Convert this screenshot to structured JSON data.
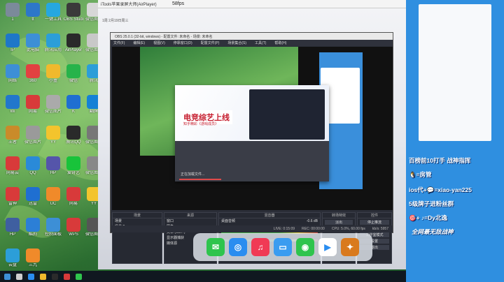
{
  "airplayer": {
    "title": "iTools苹果录屏大师(AirPlayer)",
    "fps": "58fps",
    "subtitle": "1周  2月19日周三"
  },
  "desktop_icons": [
    {
      "label": "1",
      "icon": "recycle-bin-icon",
      "color": "#7b8a9a"
    },
    {
      "label": "tt",
      "icon": "app-icon",
      "color": "#2d77c9"
    },
    {
      "label": "一键工具",
      "icon": "tool-icon",
      "color": "#26a7e0"
    },
    {
      "label": "OBS Studio",
      "icon": "obs-icon",
      "color": "#3a3a3a"
    },
    {
      "label": "微信图片",
      "icon": "image-icon",
      "color": "#d7d7d7"
    },
    {
      "label": "IP",
      "icon": "app-icon",
      "color": "#1e77c8"
    },
    {
      "label": "此电脑",
      "icon": "computer-icon",
      "color": "#3d8fd6"
    },
    {
      "label": "腾讯应用",
      "icon": "app-icon",
      "color": "#2c9ed8"
    },
    {
      "label": "AirPlayer",
      "icon": "airplayer-icon",
      "color": "#2a2a2a"
    },
    {
      "label": "微信图片",
      "icon": "image-icon",
      "color": "#c8c8c8"
    },
    {
      "label": "网络",
      "icon": "network-icon",
      "color": "#3d8fd6"
    },
    {
      "label": "360",
      "icon": "app-icon",
      "color": "#e24141"
    },
    {
      "label": "小盒",
      "icon": "app-icon",
      "color": "#f0b92d"
    },
    {
      "label": "微信",
      "icon": "wechat-icon",
      "color": "#27b34a"
    },
    {
      "label": "腾讯",
      "icon": "app-icon",
      "color": "#2c9ed8"
    },
    {
      "label": "Wi",
      "icon": "app-icon",
      "color": "#2277cc"
    },
    {
      "label": "网易",
      "icon": "app-icon",
      "color": "#d83a3a"
    },
    {
      "label": "微信图片",
      "icon": "image-icon",
      "color": "#aaaaaa"
    },
    {
      "label": "K",
      "icon": "app-icon",
      "color": "#1f6fd1"
    },
    {
      "label": "翻牌",
      "icon": "app-icon",
      "color": "#1581d6"
    },
    {
      "label": "王者",
      "icon": "game-icon",
      "color": "#c98b2a"
    },
    {
      "label": "微信图片",
      "icon": "image-icon",
      "color": "#9a9a9a"
    },
    {
      "label": "YY",
      "icon": "yy-icon",
      "color": "#f3c42d"
    },
    {
      "label": "腾讯QQ",
      "icon": "qq-icon",
      "color": "#2a2a2a"
    },
    {
      "label": "微信图片",
      "icon": "image-icon",
      "color": "#777"
    },
    {
      "label": "网易云",
      "icon": "music-icon",
      "color": "#d83a3a"
    },
    {
      "label": "QQ",
      "icon": "qq-icon",
      "color": "#2a8ad8"
    },
    {
      "label": "HP",
      "icon": "app-icon",
      "color": "#5555aa"
    },
    {
      "label": "爱奇艺",
      "icon": "iqiyi-icon",
      "color": "#18c33a"
    },
    {
      "label": "微信图片",
      "icon": "image-icon",
      "color": "#888"
    },
    {
      "label": "雷神",
      "icon": "app-icon",
      "color": "#d83a3a"
    },
    {
      "label": "迅雷",
      "icon": "app-icon",
      "color": "#1f6fd1"
    },
    {
      "label": "UC",
      "icon": "app-icon",
      "color": "#f08a2a"
    },
    {
      "label": "网易",
      "icon": "app-icon",
      "color": "#d83a3a"
    },
    {
      "label": "YY",
      "icon": "yy-icon",
      "color": "#f3c42d"
    },
    {
      "label": "HP",
      "icon": "app-icon",
      "color": "#3f5fa0"
    },
    {
      "label": "酷狗",
      "icon": "app-icon",
      "color": "#2c7fd6"
    },
    {
      "label": "控制面板",
      "icon": "control-panel-icon",
      "color": "#3d8fd6"
    },
    {
      "label": "WPS",
      "icon": "wps-icon",
      "color": "#d83a3a"
    },
    {
      "label": "微信图片",
      "icon": "image-icon",
      "color": "#555"
    },
    {
      "label": "云盘",
      "icon": "app-icon",
      "color": "#2c9ed8"
    },
    {
      "label": "三九",
      "icon": "app-icon",
      "color": "#f08a2a"
    }
  ],
  "obs": {
    "title": "OBS 25.0.1 (32-bit, windows) - 配置文件: 未命名 - 场景: 未命名",
    "menu": [
      "文件(F)",
      "编辑(E)",
      "视图(V)",
      "停靠窗口(D)",
      "配置文件(P)",
      "场景集合(S)",
      "工具(T)",
      "帮助(H)"
    ],
    "popup_brand": "电竞综艺上线",
    "popup_brand_sub": "知乎精彩《游戏成员》",
    "loading_text": "正在加载文件...",
    "dock_scenes_header": "场景",
    "scenes": [
      "场景",
      "场景 2"
    ],
    "dock_sources_header": "来源",
    "sources": [
      "窗口",
      "图像",
      "文本 (GDI+)",
      "显示器捕获",
      "媒体源"
    ],
    "dock_mixer_header": "混音器",
    "mixer_label_1": "桌面音频",
    "mixer_level": "-0.6 dB",
    "dock_transition_header": "转场特效",
    "transition_value": "淡出",
    "transition_duration": "300ms",
    "dock_controls_header": "控件",
    "controls": [
      "停止推流",
      "开始录制",
      "工作室模式",
      "设置",
      "退出"
    ],
    "status": [
      "LIVE: 0:15:09",
      "REC: 00:00:00",
      "CPU: 5.0%, 60.00 fps",
      "kb/s: 5957"
    ]
  },
  "right_panel": {
    "lines": [
      "百榜前10打手 战神指挥",
      "🐧=房管",
      "ios代+💬=xiao-yan225",
      "5级牌子进粉丝群",
      "🎯+ ♪=Dy北逸",
      "全网最无敌战神"
    ]
  },
  "colors": {
    "right_panel": "#2f8fe0",
    "accent_red": "#c51a2b",
    "obs_bg": "#2b2e38"
  }
}
